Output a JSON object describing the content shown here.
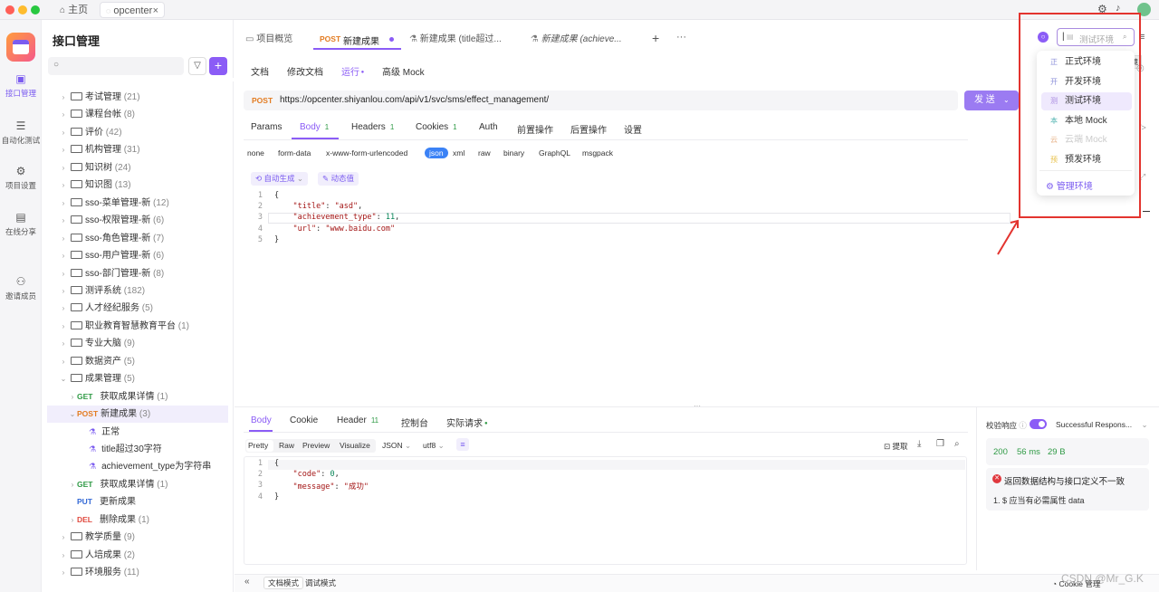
{
  "titlebar": {
    "home_tab": "主页",
    "project_tab": "opcenter"
  },
  "rail": [
    {
      "label": "接口管理",
      "icon": "api-icon"
    },
    {
      "label": "自动化测试",
      "icon": "automation-icon"
    },
    {
      "label": "项目设置",
      "icon": "settings-icon"
    },
    {
      "label": "在线分享",
      "icon": "share-icon"
    },
    {
      "label": "邀请成员",
      "icon": "invite-icon"
    }
  ],
  "sidebar": {
    "title": "接口管理",
    "search_placeholder": "",
    "tree": [
      {
        "type": "folder",
        "label": "考试管理",
        "count": "(21)"
      },
      {
        "type": "folder",
        "label": "课程台帐",
        "count": "(8)"
      },
      {
        "type": "folder",
        "label": "评价",
        "count": "(42)"
      },
      {
        "type": "folder",
        "label": "机构管理",
        "count": "(31)"
      },
      {
        "type": "folder",
        "label": "知识树",
        "count": "(24)"
      },
      {
        "type": "folder",
        "label": "知识图",
        "count": "(13)"
      },
      {
        "type": "folder",
        "label": "sso-菜单管理-新",
        "count": "(12)"
      },
      {
        "type": "folder",
        "label": "sso-权限管理-新",
        "count": "(6)"
      },
      {
        "type": "folder",
        "label": "sso-角色管理-新",
        "count": "(7)"
      },
      {
        "type": "folder",
        "label": "sso-用户管理-新",
        "count": "(6)"
      },
      {
        "type": "folder",
        "label": "sso-部门管理-新",
        "count": "(8)"
      },
      {
        "type": "folder",
        "label": "测评系统",
        "count": "(182)"
      },
      {
        "type": "folder",
        "label": "人才经纪服务",
        "count": "(5)"
      },
      {
        "type": "folder",
        "label": "职业教育智慧教育平台",
        "count": "(1)"
      },
      {
        "type": "folder",
        "label": "专业大脑",
        "count": "(9)"
      },
      {
        "type": "folder",
        "label": "数据资产",
        "count": "(5)"
      },
      {
        "type": "folder-open",
        "label": "成果管理",
        "count": "(5)"
      },
      {
        "type": "GET",
        "label": "获取成果详情",
        "count": "(1)"
      },
      {
        "type": "POST-open",
        "label": "新建成果",
        "count": "(3)"
      },
      {
        "type": "case",
        "label": "正常",
        "count": ""
      },
      {
        "type": "case",
        "label": "title超过30字符",
        "count": ""
      },
      {
        "type": "case",
        "label": "achievement_type为字符串",
        "count": ""
      },
      {
        "type": "GET",
        "label": "获取成果详情",
        "count": "(1)"
      },
      {
        "type": "PUT",
        "label": "更新成果",
        "count": ""
      },
      {
        "type": "DEL",
        "label": "删除成果",
        "count": "(1)"
      },
      {
        "type": "folder",
        "label": "教学质量",
        "count": "(9)"
      },
      {
        "type": "folder",
        "label": "人培成果",
        "count": "(2)"
      },
      {
        "type": "folder",
        "label": "环境服务",
        "count": "(11)"
      }
    ],
    "method_labels": {
      "GET": "GET",
      "POST": "POST",
      "PUT": "PUT",
      "DEL": "DEL"
    }
  },
  "tabs": {
    "overview": "项目概览",
    "active_method": "POST",
    "active": "新建成果",
    "tab3": "新建成果 (title超过...",
    "tab4": "新建成果 (achieve...",
    "add": "+",
    "more": "···"
  },
  "subtabs": [
    "文档",
    "修改文档",
    "运行",
    "高级 Mock"
  ],
  "request": {
    "method": "POST",
    "url": "https://opcenter.shiyanlou.com/api/v1/svc/sms/effect_management/",
    "send": "发 送"
  },
  "param_tabs": [
    {
      "label": "Params",
      "count": ""
    },
    {
      "label": "Body",
      "count": "1"
    },
    {
      "label": "Headers",
      "count": "1"
    },
    {
      "label": "Cookies",
      "count": "1"
    },
    {
      "label": "Auth",
      "count": ""
    },
    {
      "label": "前置操作",
      "count": ""
    },
    {
      "label": "后置操作",
      "count": ""
    },
    {
      "label": "设置",
      "count": ""
    }
  ],
  "body_types": [
    "none",
    "form-data",
    "x-www-form-urlencoded",
    "json",
    "xml",
    "raw",
    "binary",
    "GraphQL",
    "msgpack"
  ],
  "body_tools": {
    "auto": "自动生成",
    "dynamic": "动态值"
  },
  "request_body": {
    "lines": [
      {
        "n": "1",
        "text": "{"
      },
      {
        "n": "2",
        "key": "\"title\"",
        "val": "\"asd\"",
        "type": "str",
        "comma": ","
      },
      {
        "n": "3",
        "key": "\"achievement_type\"",
        "val": "11",
        "type": "num",
        "comma": ","
      },
      {
        "n": "4",
        "key": "\"url\"",
        "val": "\"www.baidu.com\"",
        "type": "str",
        "comma": ""
      },
      {
        "n": "5",
        "text": "}"
      }
    ]
  },
  "response_tabs": [
    {
      "label": "Body",
      "count": ""
    },
    {
      "label": "Cookie",
      "count": ""
    },
    {
      "label": "Header",
      "count": "11"
    },
    {
      "label": "控制台",
      "count": ""
    },
    {
      "label": "实际请求",
      "count": ""
    }
  ],
  "response_views": [
    "Pretty",
    "Raw",
    "Preview",
    "Visualize"
  ],
  "response_format": "JSON",
  "response_encoding": "utf8",
  "response_tools": {
    "extract": "提取"
  },
  "response_body": {
    "lines": [
      {
        "n": "1",
        "text": "{"
      },
      {
        "n": "2",
        "key": "\"code\"",
        "val": "0",
        "type": "num",
        "comma": ","
      },
      {
        "n": "3",
        "key": "\"message\"",
        "val": "\"成功\"",
        "type": "str",
        "comma": ""
      },
      {
        "n": "4",
        "text": "}"
      }
    ]
  },
  "validation": {
    "label": "校验响应",
    "result_select": "Successful Respons...",
    "status": "200",
    "time": "56 ms",
    "size": "29 B",
    "error": "返回数据结构与接口定义不一致",
    "detail": "1. $ 应当有必需属性 data"
  },
  "bottom": {
    "doc_mode": "文档模式",
    "debug_mode": "调试模式",
    "cookie_mgmt": "Cookie 管理",
    "watermark": "CSDN @Mr_G.K"
  },
  "env": {
    "selected": "测试环境",
    "tooltip": "测试环境",
    "items": [
      {
        "badge": "正",
        "label": "正式环境",
        "color": "#8b8fd9",
        "disabled": false
      },
      {
        "badge": "开",
        "label": "开发环境",
        "color": "#8b8fd9",
        "disabled": false
      },
      {
        "badge": "测",
        "label": "测试环境",
        "color": "#a98be0",
        "disabled": false,
        "active": true
      },
      {
        "badge": "本",
        "label": "本地 Mock",
        "color": "#4fb3b0",
        "disabled": false
      },
      {
        "badge": "云",
        "label": "云端 Mock",
        "color": "#e7b48a",
        "disabled": true
      },
      {
        "badge": "预",
        "label": "预发环境",
        "color": "#e8c04a",
        "disabled": false
      }
    ],
    "manage": "管理环境"
  },
  "colors": {
    "accent": "#8b5cf6",
    "post": "#e37c22",
    "get": "#2f9a45",
    "annotation": "#e3342f"
  }
}
